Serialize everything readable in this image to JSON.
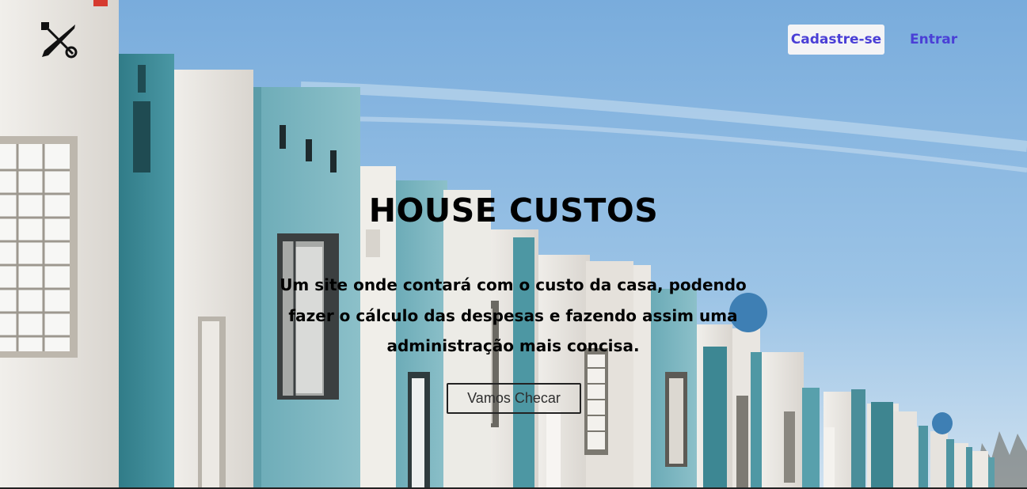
{
  "header": {
    "logo_icon": "wrench-screwdriver-icon",
    "nav": {
      "signup_label": "Cadastre-se",
      "login_label": "Entrar"
    }
  },
  "hero": {
    "background_image": "row-of-houses-photo",
    "title": "HOUSE CUSTOS",
    "subtitle": "Um site onde contará com o custo da casa, podendo fazer o cálculo das despesas e fazendo assim uma administração mais concisa.",
    "cta_label": "Vamos Checar"
  },
  "colors": {
    "accent": "#4a3fd6",
    "sky": "#8db8e0",
    "wall_teal": "#3f8b98",
    "wall_white": "#e9e6e1"
  }
}
